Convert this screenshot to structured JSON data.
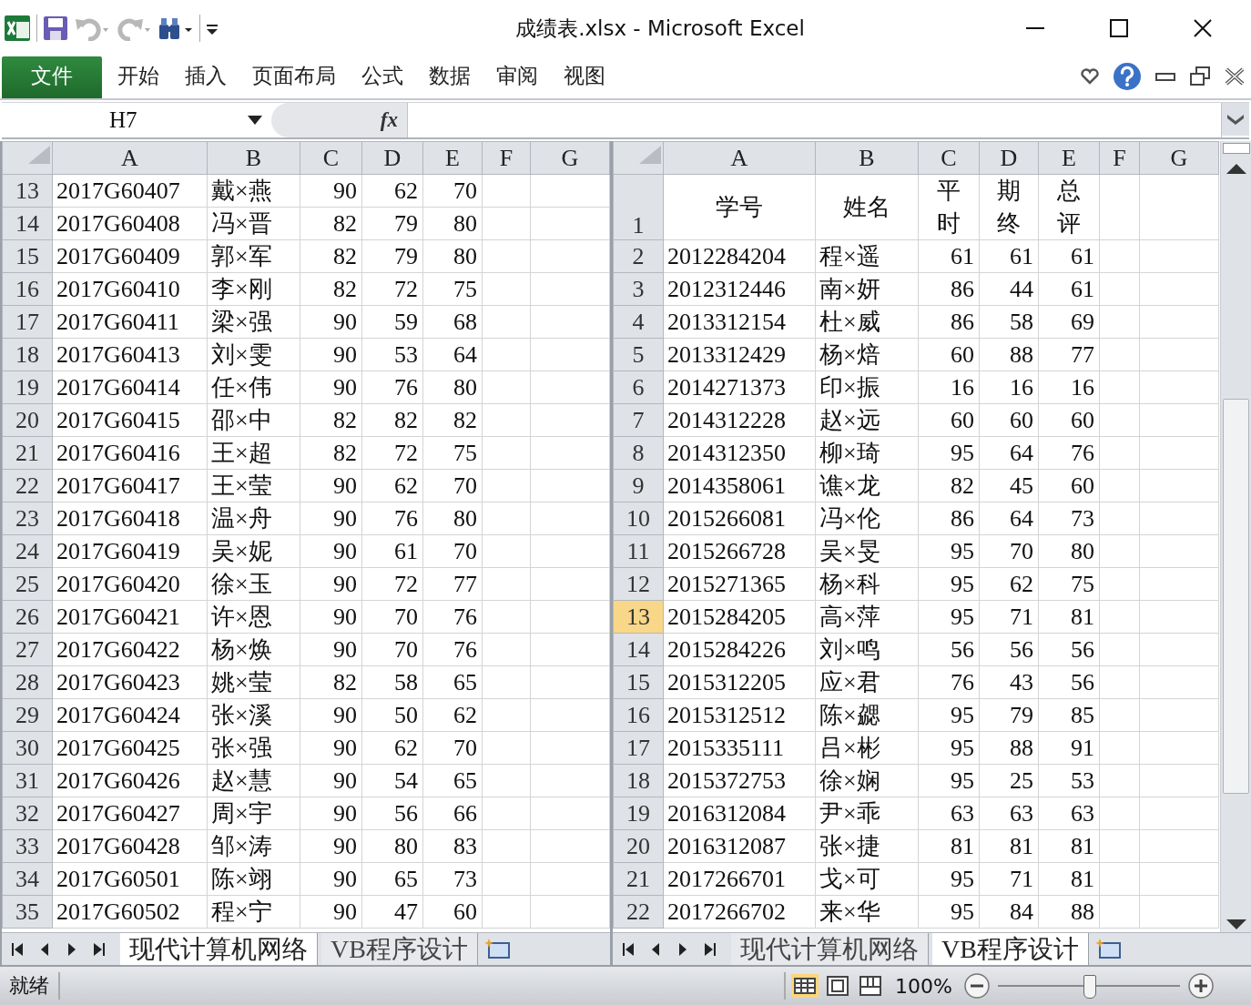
{
  "window": {
    "title": "成绩表.xlsx  -  Microsoft Excel"
  },
  "ribbon_tabs": [
    {
      "label": "文件",
      "selected": true
    },
    {
      "label": "开始",
      "selected": false
    },
    {
      "label": "插入",
      "selected": false
    },
    {
      "label": "页面布局",
      "selected": false
    },
    {
      "label": "公式",
      "selected": false
    },
    {
      "label": "数据",
      "selected": false
    },
    {
      "label": "审阅",
      "selected": false
    },
    {
      "label": "视图",
      "selected": false
    }
  ],
  "formula_bar": {
    "name_box": "H7",
    "fx": "fx"
  },
  "panes": [
    {
      "columns": [
        "A",
        "B",
        "C",
        "D",
        "E",
        "F",
        "G"
      ],
      "rows": [
        {
          "header": "13",
          "selected": false,
          "kind": "data",
          "cells": [
            "2017G60407",
            "戴×燕",
            "90",
            "62",
            "70"
          ]
        },
        {
          "header": "14",
          "selected": false,
          "kind": "data",
          "cells": [
            "2017G60408",
            "冯×晋",
            "82",
            "79",
            "80"
          ]
        },
        {
          "header": "15",
          "selected": false,
          "kind": "data",
          "cells": [
            "2017G60409",
            "郭×军",
            "82",
            "79",
            "80"
          ]
        },
        {
          "header": "16",
          "selected": false,
          "kind": "data",
          "cells": [
            "2017G60410",
            "李×刚",
            "82",
            "72",
            "75"
          ]
        },
        {
          "header": "17",
          "selected": false,
          "kind": "data",
          "cells": [
            "2017G60411",
            "梁×强",
            "90",
            "59",
            "68"
          ]
        },
        {
          "header": "18",
          "selected": false,
          "kind": "data",
          "cells": [
            "2017G60413",
            "刘×雯",
            "90",
            "53",
            "64"
          ]
        },
        {
          "header": "19",
          "selected": false,
          "kind": "data",
          "cells": [
            "2017G60414",
            "任×伟",
            "90",
            "76",
            "80"
          ]
        },
        {
          "header": "20",
          "selected": false,
          "kind": "data",
          "cells": [
            "2017G60415",
            "邵×中",
            "82",
            "82",
            "82"
          ]
        },
        {
          "header": "21",
          "selected": false,
          "kind": "data",
          "cells": [
            "2017G60416",
            "王×超",
            "82",
            "72",
            "75"
          ]
        },
        {
          "header": "22",
          "selected": false,
          "kind": "data",
          "cells": [
            "2017G60417",
            "王×莹",
            "90",
            "62",
            "70"
          ]
        },
        {
          "header": "23",
          "selected": false,
          "kind": "data",
          "cells": [
            "2017G60418",
            "温×舟",
            "90",
            "76",
            "80"
          ]
        },
        {
          "header": "24",
          "selected": false,
          "kind": "data",
          "cells": [
            "2017G60419",
            "吴×妮",
            "90",
            "61",
            "70"
          ]
        },
        {
          "header": "25",
          "selected": false,
          "kind": "data",
          "cells": [
            "2017G60420",
            "徐×玉",
            "90",
            "72",
            "77"
          ]
        },
        {
          "header": "26",
          "selected": false,
          "kind": "data",
          "cells": [
            "2017G60421",
            "许×恩",
            "90",
            "70",
            "76"
          ]
        },
        {
          "header": "27",
          "selected": false,
          "kind": "data",
          "cells": [
            "2017G60422",
            "杨×焕",
            "90",
            "70",
            "76"
          ]
        },
        {
          "header": "28",
          "selected": false,
          "kind": "data",
          "cells": [
            "2017G60423",
            "姚×莹",
            "82",
            "58",
            "65"
          ]
        },
        {
          "header": "29",
          "selected": false,
          "kind": "data",
          "cells": [
            "2017G60424",
            "张×溪",
            "90",
            "50",
            "62"
          ]
        },
        {
          "header": "30",
          "selected": false,
          "kind": "data",
          "cells": [
            "2017G60425",
            "张×强",
            "90",
            "62",
            "70"
          ]
        },
        {
          "header": "31",
          "selected": false,
          "kind": "data",
          "cells": [
            "2017G60426",
            "赵×慧",
            "90",
            "54",
            "65"
          ]
        },
        {
          "header": "32",
          "selected": false,
          "kind": "data",
          "cells": [
            "2017G60427",
            "周×宇",
            "90",
            "56",
            "66"
          ]
        },
        {
          "header": "33",
          "selected": false,
          "kind": "data",
          "cells": [
            "2017G60428",
            "邹×涛",
            "90",
            "80",
            "83"
          ]
        },
        {
          "header": "34",
          "selected": false,
          "kind": "data",
          "cells": [
            "2017G60501",
            "陈×翊",
            "90",
            "65",
            "73"
          ]
        },
        {
          "header": "35",
          "selected": false,
          "kind": "data",
          "cells": [
            "2017G60502",
            "程×宁",
            "90",
            "47",
            "60"
          ]
        }
      ],
      "sheet_tabs": [
        {
          "label": "现代计算机网络",
          "selected": true
        },
        {
          "label": "VB程序设计",
          "selected": false
        }
      ]
    },
    {
      "columns": [
        "A",
        "B",
        "C",
        "D",
        "E",
        "F",
        "G"
      ],
      "rows": [
        {
          "header": "1",
          "selected": false,
          "kind": "title",
          "cells": [
            "学号",
            "姓名",
            "平时",
            "期终",
            "总评"
          ]
        },
        {
          "header": "2",
          "selected": false,
          "kind": "data",
          "cells": [
            "2012284204",
            "程×遥",
            "61",
            "61",
            "61"
          ]
        },
        {
          "header": "3",
          "selected": false,
          "kind": "data",
          "cells": [
            "2012312446",
            "南×妍",
            "86",
            "44",
            "61"
          ]
        },
        {
          "header": "4",
          "selected": false,
          "kind": "data",
          "cells": [
            "2013312154",
            "杜×威",
            "86",
            "58",
            "69"
          ]
        },
        {
          "header": "5",
          "selected": false,
          "kind": "data",
          "cells": [
            "2013312429",
            "杨×焙",
            "60",
            "88",
            "77"
          ]
        },
        {
          "header": "6",
          "selected": false,
          "kind": "data",
          "cells": [
            "2014271373",
            "印×振",
            "16",
            "16",
            "16"
          ]
        },
        {
          "header": "7",
          "selected": false,
          "kind": "data",
          "cells": [
            "2014312228",
            "赵×远",
            "60",
            "60",
            "60"
          ]
        },
        {
          "header": "8",
          "selected": false,
          "kind": "data",
          "cells": [
            "2014312350",
            "柳×琦",
            "95",
            "64",
            "76"
          ]
        },
        {
          "header": "9",
          "selected": false,
          "kind": "data",
          "cells": [
            "2014358061",
            "谯×龙",
            "82",
            "45",
            "60"
          ]
        },
        {
          "header": "10",
          "selected": false,
          "kind": "data",
          "cells": [
            "2015266081",
            "冯×伦",
            "86",
            "64",
            "73"
          ]
        },
        {
          "header": "11",
          "selected": false,
          "kind": "data",
          "cells": [
            "2015266728",
            "吴×旻",
            "95",
            "70",
            "80"
          ]
        },
        {
          "header": "12",
          "selected": false,
          "kind": "data",
          "cells": [
            "2015271365",
            "杨×科",
            "95",
            "62",
            "75"
          ]
        },
        {
          "header": "13",
          "selected": true,
          "kind": "data",
          "cells": [
            "2015284205",
            "高×萍",
            "95",
            "71",
            "81"
          ]
        },
        {
          "header": "14",
          "selected": false,
          "kind": "data",
          "cells": [
            "2015284226",
            "刘×鸣",
            "56",
            "56",
            "56"
          ]
        },
        {
          "header": "15",
          "selected": false,
          "kind": "data",
          "cells": [
            "2015312205",
            "应×君",
            "76",
            "43",
            "56"
          ]
        },
        {
          "header": "16",
          "selected": false,
          "kind": "data",
          "cells": [
            "2015312512",
            "陈×勰",
            "95",
            "79",
            "85"
          ]
        },
        {
          "header": "17",
          "selected": false,
          "kind": "data",
          "cells": [
            "2015335111",
            "吕×彬",
            "95",
            "88",
            "91"
          ]
        },
        {
          "header": "18",
          "selected": false,
          "kind": "data",
          "cells": [
            "2015372753",
            "徐×娴",
            "95",
            "25",
            "53"
          ]
        },
        {
          "header": "19",
          "selected": false,
          "kind": "data",
          "cells": [
            "2016312084",
            "尹×乖",
            "63",
            "63",
            "63"
          ]
        },
        {
          "header": "20",
          "selected": false,
          "kind": "data",
          "cells": [
            "2016312087",
            "张×捷",
            "81",
            "81",
            "81"
          ]
        },
        {
          "header": "21",
          "selected": false,
          "kind": "data",
          "cells": [
            "2017266701",
            "戈×可",
            "95",
            "71",
            "81"
          ]
        },
        {
          "header": "22",
          "selected": false,
          "kind": "data",
          "cells": [
            "2017266702",
            "来×华",
            "95",
            "84",
            "88"
          ]
        }
      ],
      "sheet_tabs": [
        {
          "label": "现代计算机网络",
          "selected": false
        },
        {
          "label": "VB程序设计",
          "selected": true
        }
      ]
    }
  ],
  "status_bar": {
    "text": "就绪",
    "views": [
      {
        "kind": "normal",
        "selected": true
      },
      {
        "kind": "page-layout",
        "selected": false
      },
      {
        "kind": "page-break",
        "selected": false
      }
    ],
    "zoom": "100%",
    "zoom_slider": {
      "level": 0.5
    }
  }
}
